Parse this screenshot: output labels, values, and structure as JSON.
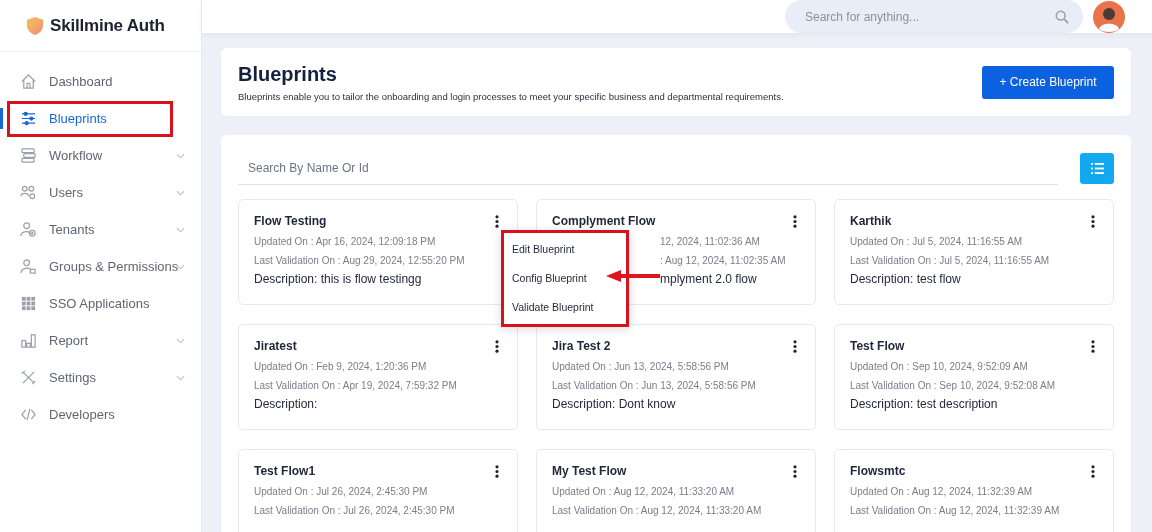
{
  "brand": "Skillmine Auth",
  "sidebar": {
    "items": [
      {
        "label": "Dashboard",
        "selected": false,
        "expandable": false,
        "highlighted": false
      },
      {
        "label": "Blueprints",
        "selected": true,
        "expandable": false,
        "highlighted": true
      },
      {
        "label": "Workflow",
        "selected": false,
        "expandable": true,
        "highlighted": false
      },
      {
        "label": "Users",
        "selected": false,
        "expandable": true,
        "highlighted": false
      },
      {
        "label": "Tenants",
        "selected": false,
        "expandable": true,
        "highlighted": false
      },
      {
        "label": "Groups & Permissions",
        "selected": false,
        "expandable": true,
        "highlighted": false
      },
      {
        "label": "SSO Applications",
        "selected": false,
        "expandable": false,
        "highlighted": false
      },
      {
        "label": "Report",
        "selected": false,
        "expandable": true,
        "highlighted": false
      },
      {
        "label": "Settings",
        "selected": false,
        "expandable": true,
        "highlighted": false
      },
      {
        "label": "Developers",
        "selected": false,
        "expandable": false,
        "highlighted": false
      }
    ]
  },
  "header": {
    "search": {
      "placeholder": "Search for anything..."
    }
  },
  "page": {
    "title": "Blueprints",
    "subtitle": "Blueprints enable you to tailor the onboarding and login processes to meet your specific business and departmental requirements.",
    "create_button": "+ Create Blueprint"
  },
  "filter": {
    "placeholder": "Search By Name Or Id"
  },
  "cards": [
    {
      "name": "Flow Testing",
      "updated": "Updated On : Apr 16, 2024, 12:09:18 PM",
      "validated": "Last Validation On : Aug 29, 2024, 12:55:20 PM",
      "description": "Description: this is flow testingg",
      "partly_hidden": false
    },
    {
      "name": "Complyment Flow",
      "updated": "12, 2024, 11:02:36 AM",
      "validated": ": Aug 12, 2024, 11:02:35 AM",
      "description": "mplyment 2.0 flow",
      "partly_hidden": true
    },
    {
      "name": "Karthik",
      "updated": "Updated On : Jul 5, 2024, 11:16:55 AM",
      "validated": "Last Validation On : Jul 5, 2024, 11:16:55 AM",
      "description": "Description: test flow",
      "partly_hidden": false
    },
    {
      "name": "Jiratest",
      "updated": "Updated On : Feb 9, 2024, 1:20:36 PM",
      "validated": "Last Validation On : Apr 19, 2024, 7:59:32 PM",
      "description": "Description:",
      "partly_hidden": false
    },
    {
      "name": "Jira Test 2",
      "updated": "Updated On : Jun 13, 2024, 5:58:56 PM",
      "validated": "Last Validation On : Jun 13, 2024, 5:58:56 PM",
      "description": "Description: Dont know",
      "partly_hidden": false
    },
    {
      "name": "Test Flow",
      "updated": "Updated On : Sep 10, 2024, 9:52:09 AM",
      "validated": "Last Validation On : Sep 10, 2024, 9:52:08 AM",
      "description": "Description: test description",
      "partly_hidden": false
    },
    {
      "name": "Test Flow1",
      "updated": "Updated On : Jul 26, 2024, 2:45:30 PM",
      "validated": "Last Validation On : Jul 26, 2024, 2:45:30 PM",
      "partly_hidden": false
    },
    {
      "name": "My Test Flow",
      "updated": "Updated On : Aug 12, 2024, 11:33:20 AM",
      "validated": "Last Validation On : Aug 12, 2024, 11:33:20 AM",
      "partly_hidden": false
    },
    {
      "name": "Flowsmtc",
      "updated": "Updated On : Aug 12, 2024, 11:32:39 AM",
      "validated": "Last Validation On : Aug 12, 2024, 11:32:39 AM",
      "partly_hidden": false
    }
  ],
  "context_menu": {
    "items": [
      "Edit Blueprint",
      "Config Blueprint",
      "Validate Blueprint"
    ],
    "highlighted": true
  }
}
